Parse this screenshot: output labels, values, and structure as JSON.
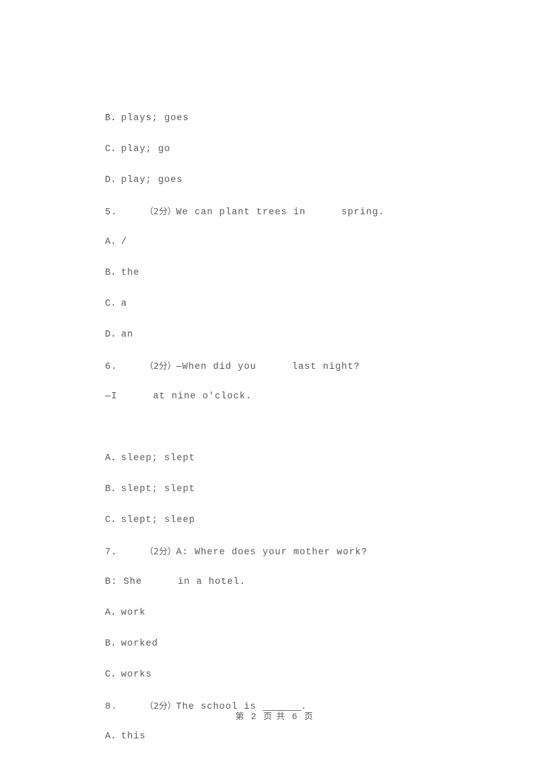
{
  "document": {
    "page_footer": {
      "prefix": "第",
      "current_page": "2",
      "middle": "页 共",
      "total_pages": "6",
      "suffix": "页",
      "full_text": "第 2 页 共 6 页"
    },
    "lines": [
      {
        "id": "q4-option-b",
        "kind": "option",
        "text": "B．plays; goes"
      },
      {
        "id": "q4-option-c",
        "kind": "option",
        "text": "C．play; go"
      },
      {
        "id": "q4-option-d",
        "kind": "option",
        "text": "D．play; goes"
      },
      {
        "id": "q5-stem",
        "kind": "question",
        "number": "5.",
        "score": "（2分）",
        "text": "We can plant trees in",
        "tail": "spring."
      },
      {
        "id": "q5-option-a",
        "kind": "option",
        "text": "A．/"
      },
      {
        "id": "q5-option-b",
        "kind": "option",
        "text": "B．the"
      },
      {
        "id": "q5-option-c",
        "kind": "option",
        "text": "C．a"
      },
      {
        "id": "q5-option-d",
        "kind": "option",
        "text": "D．an"
      },
      {
        "id": "q6-stem",
        "kind": "question",
        "number": "6.",
        "score": "（2分）",
        "text": "—When did you",
        "tail": "last night?"
      },
      {
        "id": "q6-stem-line2",
        "kind": "question-cont",
        "text": "—I",
        "tail": "at nine o'clock."
      },
      {
        "id": "q6-spacer",
        "kind": "blank",
        "text": ""
      },
      {
        "id": "q6-option-a",
        "kind": "option",
        "text": "A．sleep; slept"
      },
      {
        "id": "q6-option-b",
        "kind": "option",
        "text": "B．slept; slept"
      },
      {
        "id": "q6-option-c",
        "kind": "option",
        "text": "C．slept; sleep"
      },
      {
        "id": "q7-stem",
        "kind": "question",
        "number": "7.",
        "score": "（2分）",
        "text": "A: Where does your mother work?",
        "tail": ""
      },
      {
        "id": "q7-stem-line2",
        "kind": "question-cont",
        "text": "B: She",
        "tail": "in a hotel."
      },
      {
        "id": "q7-option-a",
        "kind": "option",
        "text": "A．work"
      },
      {
        "id": "q7-option-b",
        "kind": "option",
        "text": "B．worked"
      },
      {
        "id": "q7-option-c",
        "kind": "option",
        "text": "C．works"
      },
      {
        "id": "q8-stem",
        "kind": "question-blankline",
        "number": "8.",
        "score": "（2分）",
        "text": "The school is",
        "tail": "."
      },
      {
        "id": "q8-option-a",
        "kind": "option",
        "text": "A．this"
      }
    ]
  }
}
